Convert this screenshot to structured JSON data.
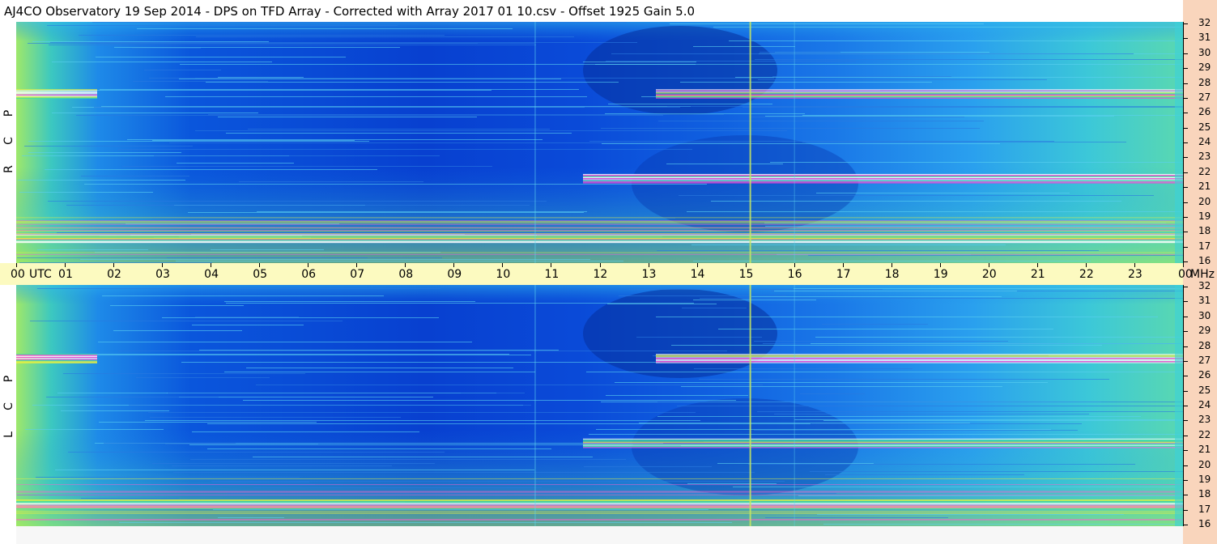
{
  "title": "AJ4CO Observatory  19 Sep 2014  -  DPS on TFD Array  -  Corrected with Array 2017 01 10.csv  -  Offset 1925  Gain 5.0",
  "panels": [
    {
      "name": "RCP",
      "letters": [
        "P",
        "C",
        "R"
      ]
    },
    {
      "name": "LCP",
      "letters": [
        "P",
        "C",
        "L"
      ]
    }
  ],
  "time_axis": {
    "labels": [
      "00",
      "01",
      "02",
      "03",
      "04",
      "05",
      "06",
      "07",
      "08",
      "09",
      "10",
      "11",
      "12",
      "13",
      "14",
      "15",
      "16",
      "17",
      "18",
      "19",
      "20",
      "21",
      "22",
      "23",
      "00"
    ],
    "start_unit": "UTC",
    "end_unit": "MHz"
  },
  "freq_axis": {
    "labels": [
      "32",
      "31",
      "30",
      "29",
      "28",
      "27",
      "26",
      "25",
      "24",
      "23",
      "22",
      "21",
      "20",
      "19",
      "18",
      "17",
      "16"
    ]
  },
  "colors": {
    "background_deep": "#0a3fd0",
    "background_mid": "#1e8ae8",
    "interference_bands": [
      "#ffffff",
      "#ff3fd0",
      "#e8f040",
      "#40e0a0"
    ]
  },
  "chart_data": {
    "type": "heatmap",
    "title": "AJ4CO Observatory  19 Sep 2014  -  DPS on TFD Array  -  Corrected with Array 2017 01 10.csv  -  Offset 1925  Gain 5.0",
    "xlabel": "UTC",
    "ylabel": "MHz",
    "x_range": [
      0,
      24
    ],
    "y_range": [
      16,
      32
    ],
    "series": [
      {
        "name": "RCP",
        "strong_bands_mhz": [
          27.3,
          17.6,
          21.6
        ]
      },
      {
        "name": "LCP",
        "strong_bands_mhz": [
          27.2,
          17.4,
          21.5
        ]
      }
    ],
    "vertical_feature_utc": 15.1
  }
}
